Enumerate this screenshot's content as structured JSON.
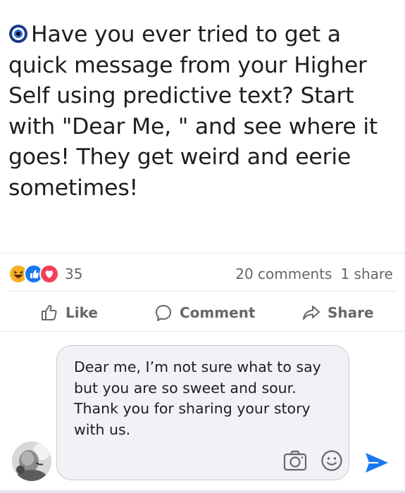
{
  "post": {
    "text": "Have you ever tried to get a quick message from your Higher Self using predictive text? Start with \"Dear Me, \" and see where it goes! They get weird and eerie sometimes!"
  },
  "reactions": {
    "types": [
      "haha",
      "like",
      "love"
    ],
    "count": "35",
    "comments": "20 comments",
    "shares": "1 share"
  },
  "actions": {
    "like": "Like",
    "comment": "Comment",
    "share": "Share"
  },
  "comment_box": {
    "value": "Dear me, I’m not sure what to say but you are so sweet and sour. Thank you for sharing your story with us."
  },
  "colors": {
    "text": "#1c1e21",
    "muted": "#65676b",
    "bubble": "#f0f2f5",
    "accent": "#1877f2",
    "love": "#f33e58",
    "haha": "#f7b125"
  }
}
